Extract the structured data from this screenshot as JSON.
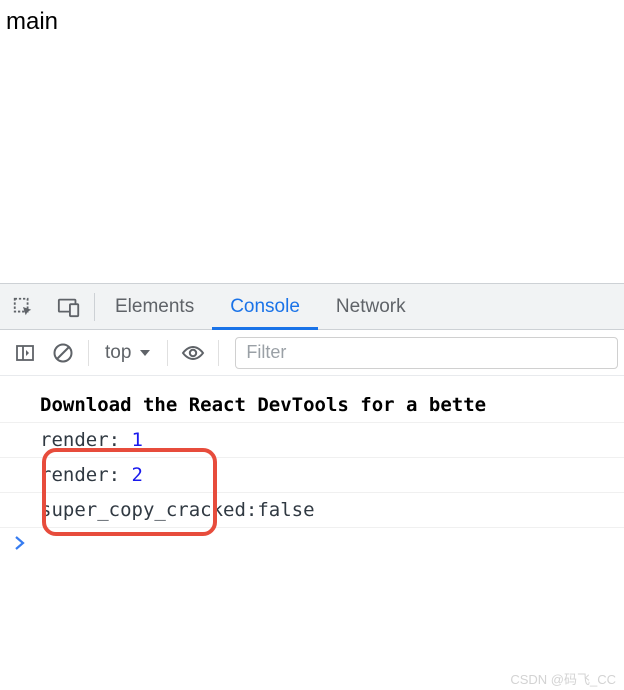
{
  "page": {
    "text": "main"
  },
  "devtools": {
    "tabs": {
      "elements": "Elements",
      "console": "Console",
      "network": "Network"
    },
    "toolbar": {
      "context": "top",
      "filter_placeholder": "Filter"
    },
    "console": {
      "devtools_hint": "Download the React DevTools for a bette",
      "log1": {
        "label": "render: ",
        "value": "1"
      },
      "log2": {
        "label": "render: ",
        "value": "2"
      },
      "log3": "super_copy_cracked:false"
    }
  },
  "watermark": "CSDN @码飞_CC"
}
